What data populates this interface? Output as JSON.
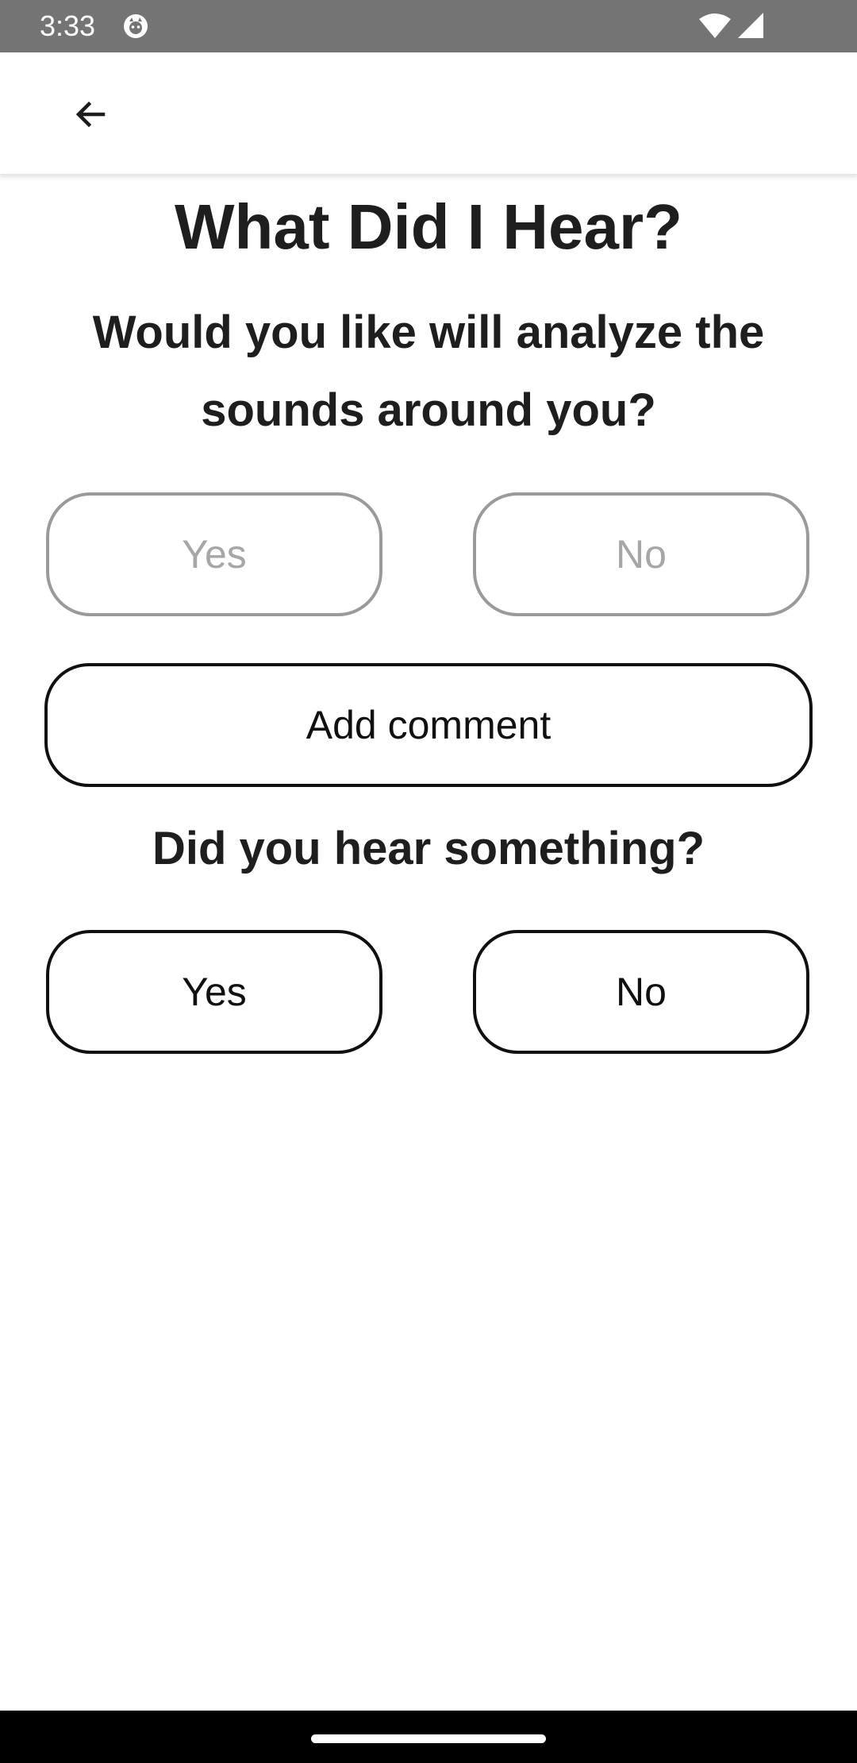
{
  "status_bar": {
    "time": "3:33",
    "icons": [
      "app-notification-icon",
      "wifi-icon",
      "signal-icon"
    ],
    "background_color": "#747474"
  },
  "app_bar": {
    "back_icon": "arrow-left-icon"
  },
  "main": {
    "title": "What Did I Hear?",
    "question_1": "Would you like will analyze the sounds around you?",
    "question_1_buttons": {
      "yes_label": "Yes",
      "no_label": "No",
      "state": "disabled"
    },
    "comment_button_label": "Add comment",
    "question_2": "Did you hear something?",
    "question_2_buttons": {
      "yes_label": "Yes",
      "no_label": "No",
      "state": "enabled"
    }
  },
  "colors": {
    "text": "#1e1e1e",
    "disabled_border": "#9a9a9a",
    "disabled_text": "#a6a6a6",
    "active_border": "#101010"
  }
}
